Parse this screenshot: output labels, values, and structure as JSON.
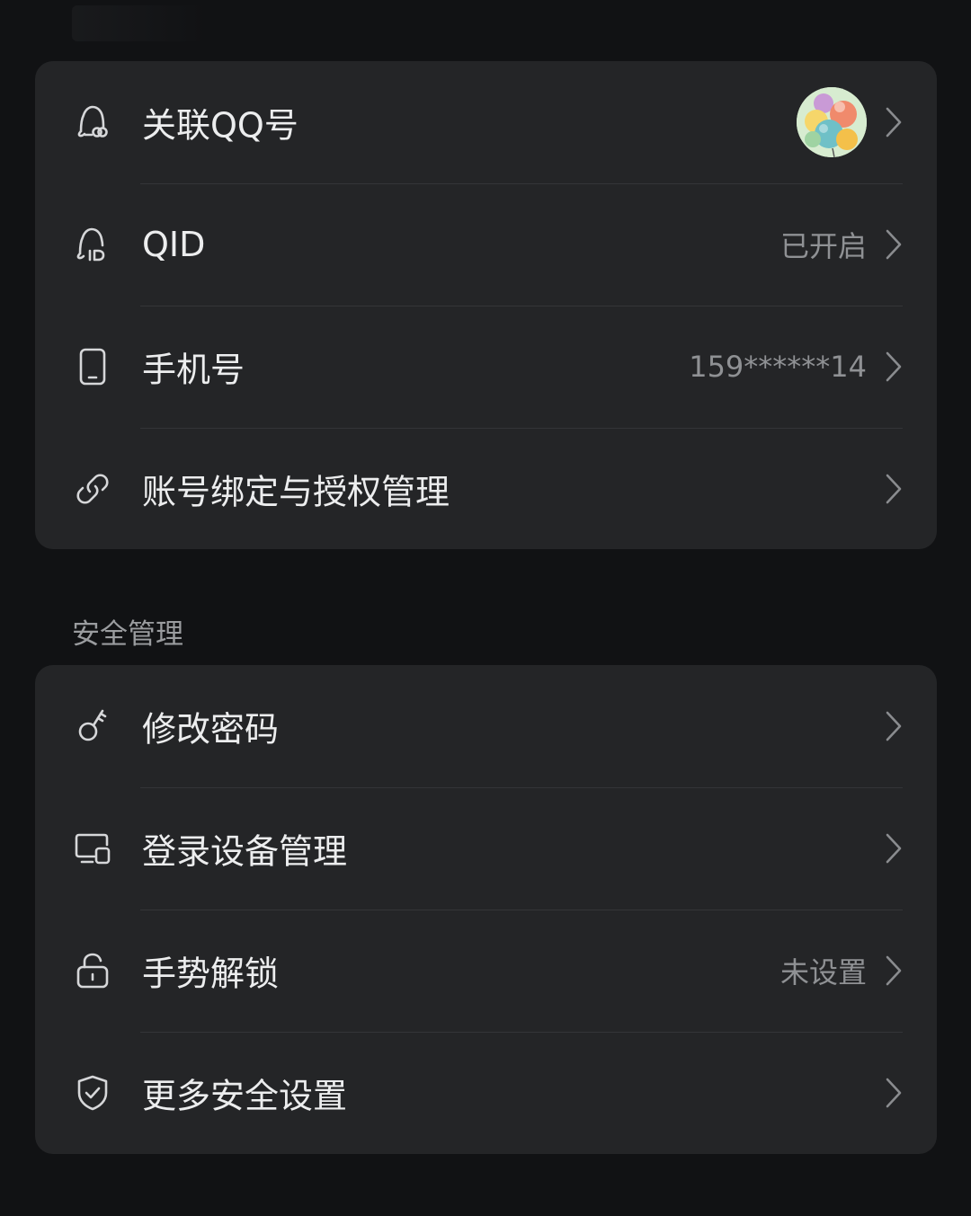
{
  "account_group": {
    "items": [
      {
        "label": "关联QQ号",
        "icon": "qq-link-icon",
        "value": ""
      },
      {
        "label": "QID",
        "icon": "qid-icon",
        "value": "已开启"
      },
      {
        "label": "手机号",
        "icon": "phone-icon",
        "value": "159******14"
      },
      {
        "label": "账号绑定与授权管理",
        "icon": "link-icon",
        "value": ""
      }
    ]
  },
  "security_group": {
    "title": "安全管理",
    "items": [
      {
        "label": "修改密码",
        "icon": "key-icon",
        "value": ""
      },
      {
        "label": "登录设备管理",
        "icon": "devices-icon",
        "value": ""
      },
      {
        "label": "手势解锁",
        "icon": "lock-icon",
        "value": "未设置"
      },
      {
        "label": "更多安全设置",
        "icon": "shield-check-icon",
        "value": ""
      }
    ]
  },
  "colors": {
    "background": "#111214",
    "card": "#242527",
    "divider": "#343538",
    "primary_text": "#ecedee",
    "secondary_text": "#8f9194",
    "icon_stroke": "#d6d7d9",
    "chevron": "#8a8c8f"
  }
}
